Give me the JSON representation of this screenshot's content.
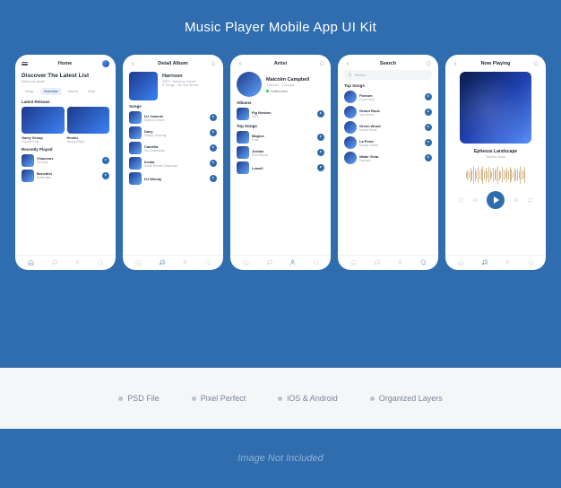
{
  "banner": {
    "title": "Music Player Mobile App UI Kit"
  },
  "features": [
    "PSD File",
    "Pixel Perfect",
    "iOS & Android",
    "Organized Layers"
  ],
  "footer": {
    "note": "Image Not Included"
  },
  "nav": {
    "items": [
      "home",
      "music",
      "user",
      "search"
    ]
  },
  "screens": {
    "home": {
      "header": "Home",
      "headline": "Discover The Latest List",
      "headline_sub": "Welcome Back!",
      "tabs": [
        "Songs",
        "Overview",
        "Albums",
        "Artist"
      ],
      "active_tab": 1,
      "latest_label": "Latest Release",
      "latest": [
        {
          "title": "Garry Group",
          "sub": "Popular Song"
        },
        {
          "title": "Hector",
          "sub": "Anchor Player"
        }
      ],
      "recent_label": "Recently Played",
      "recent": [
        {
          "title": "Vivacious",
          "sub": "Sin Soan"
        },
        {
          "title": "Benedict",
          "sub": "Beatmatisa"
        }
      ],
      "nav_active": 0
    },
    "album": {
      "header": "Detail Album",
      "name": "Harrison",
      "meta_year": "2023",
      "meta_artist": "Anthony Garner",
      "meta_songs": "5 Songs · 28 min 58 sec",
      "songs_label": "Songs",
      "songs": [
        {
          "title": "DJ Jeannie",
          "sub": "Moment Cleans"
        },
        {
          "title": "Davy",
          "sub": "Snappy Sourcing"
        },
        {
          "title": "Camélia",
          "sub": "Hip Commission"
        },
        {
          "title": "Incala",
          "sub": "Secret Eternal Conspiracy"
        },
        {
          "title": "DJ Wendy",
          "sub": ""
        }
      ],
      "nav_active": 1
    },
    "artist": {
      "header": "Artist",
      "name": "Malcolm Campbell",
      "sub": "1 Album · 3 Songs",
      "verified": "Verified Artist",
      "albums_label": "Albums",
      "albums": [
        {
          "title": "Fig Newton",
          "sub": "2022"
        }
      ],
      "top_label": "Top Songs",
      "top": [
        {
          "title": "Magica",
          "sub": "Food"
        },
        {
          "title": "Jordan",
          "sub": "Deal Rejoice"
        },
        {
          "title": "Lowell",
          "sub": ""
        }
      ],
      "nav_active": 2
    },
    "search": {
      "header": "Search",
      "placeholder": "Search…",
      "top_label": "Top Songs",
      "songs": [
        {
          "title": "Florium",
          "sub": "Crowd Step"
        },
        {
          "title": "Grand Rock",
          "sub": "Jazz Metric"
        },
        {
          "title": "Green Wood",
          "sub": "Carmel World"
        },
        {
          "title": "La Perla",
          "sub": "Society Justice"
        },
        {
          "title": "Wade Vista",
          "sub": "Danmark"
        }
      ],
      "nav_active": 3
    },
    "now_playing": {
      "header": "Now Playing",
      "track": "Ephesus Landscape",
      "artist": "Tectonic Mode",
      "nav_active": 1
    }
  }
}
